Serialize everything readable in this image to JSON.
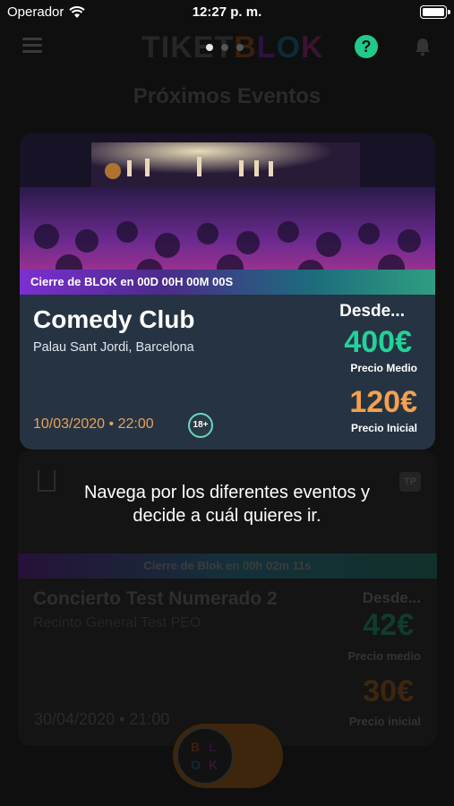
{
  "status_bar": {
    "carrier": "Operador",
    "time": "12:27 p. m."
  },
  "header": {
    "logo_text_tiket": "TIKET",
    "logo_text_blok": "BLOK",
    "help_label": "?"
  },
  "section_title": "Próximos Eventos",
  "featured_event": {
    "countdown": "Cierre de BLOK en 00D 00H 00M 00S",
    "name": "Comedy Club",
    "venue": "Palau Sant Jordi, Barcelona",
    "datetime": "10/03/2020 • 22:00",
    "age_badge": "18+",
    "from_label": "Desde...",
    "price_medio": "400€",
    "price_medio_label": "Precio Medio",
    "price_inicial": "120€",
    "price_inicial_label": "Precio Inicial"
  },
  "second_event": {
    "badge": "TP",
    "countdown": "Cierre de Blok en 00h 02m 11s",
    "name": "Concierto Test Numerado 2",
    "venue": "Recinto General Test PEO",
    "from_label": "Desde...",
    "price_medio": "42€",
    "price_medio_label": "Precio medio",
    "price_inicial": "30€",
    "price_inicial_label": "Precio inicial",
    "datetime": "30/04/2020 • 21:00"
  },
  "blok_toggle": {
    "letters": [
      "B",
      "L",
      "O",
      "K"
    ]
  },
  "tooltip": {
    "line1": "Navega por los diferentes eventos y",
    "line2": "decide a cuál quieres ir."
  },
  "colors": {
    "accent_green": "#23d29a",
    "accent_orange": "#f2a14f",
    "card_bg": "#263342"
  }
}
